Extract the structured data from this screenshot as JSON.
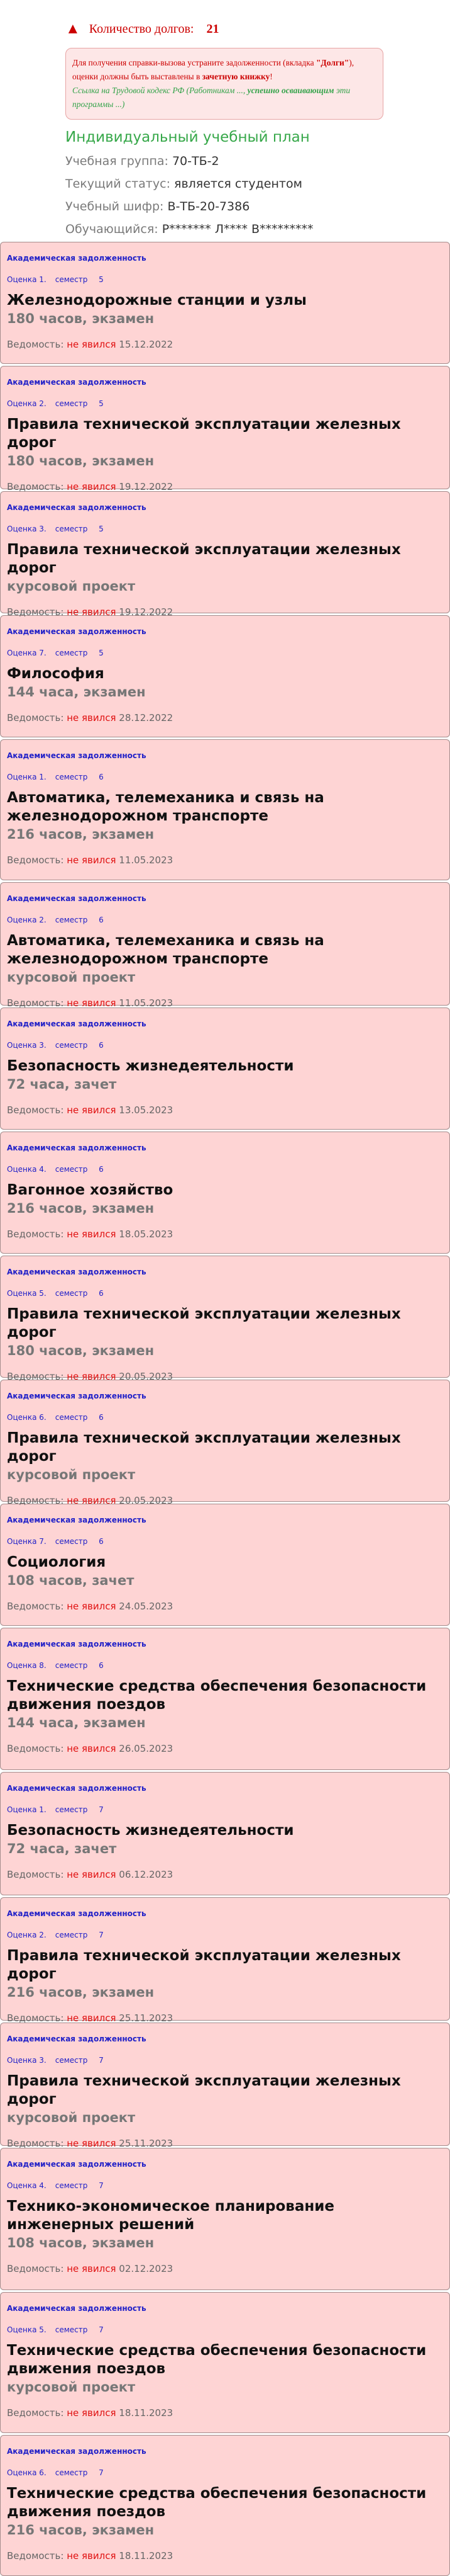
{
  "debts": {
    "label": "Количество долгов:",
    "count": "21"
  },
  "notice": {
    "message_pre": "Для получения справки-вызова устраните задолженности (вкладка ",
    "message_tab": "\"Долги\"",
    "message_post": "), оценки должны быть выставлены в ",
    "message_book": "зачетную книжку",
    "message_end": "!",
    "link_pre": "Ссылка на Трудовой кодекс РФ (Работникам ..., ",
    "link_bold": "успешно осваивающим",
    "link_post": " эти программы ...)"
  },
  "plan_title": "Индивидуальный учебный план",
  "info": {
    "group_label": "Учебная группа:",
    "group_value": "70-ТБ-2",
    "status_label": "Текущий статус:",
    "status_value": "является студентом",
    "cipher_label": "Учебный шифр:",
    "cipher_value": "В-ТБ-20-7386",
    "student_label": "Обучающийся:",
    "student_value": "Р******* Л**** В*********"
  },
  "labels": {
    "debt_tag": "Академическая задолженность",
    "semester": "семестр",
    "statement": "Ведомость:",
    "absent": "не явился"
  },
  "debts_list": [
    {
      "grade": "Оценка 1.",
      "semester": "5",
      "title": "Железнодорожные станции и узлы",
      "hours": "180 часов, экзамен",
      "date": "15.12.2022"
    },
    {
      "grade": "Оценка 2.",
      "semester": "5",
      "title": "Правила технической эксплуатации железных дорог",
      "hours": "180 часов, экзамен",
      "date": "19.12.2022"
    },
    {
      "grade": "Оценка 3.",
      "semester": "5",
      "title": "Правила технической эксплуатации железных дорог",
      "hours": "курсовой проект",
      "date": "19.12.2022"
    },
    {
      "grade": "Оценка 7.",
      "semester": "5",
      "title": "Философия",
      "hours": "144 часа, экзамен",
      "date": "28.12.2022"
    },
    {
      "grade": "Оценка 1.",
      "semester": "6",
      "title": "Автоматика, телемеханика и связь на железнодорожном транспорте",
      "hours": "216 часов, экзамен",
      "date": "11.05.2023"
    },
    {
      "grade": "Оценка 2.",
      "semester": "6",
      "title": "Автоматика, телемеханика и связь на железнодорожном транспорте",
      "hours": "курсовой проект",
      "date": "11.05.2023"
    },
    {
      "grade": "Оценка 3.",
      "semester": "6",
      "title": "Безопасность жизнедеятельности",
      "hours": "72 часа, зачет",
      "date": "13.05.2023"
    },
    {
      "grade": "Оценка 4.",
      "semester": "6",
      "title": "Вагонное хозяйство",
      "hours": "216 часов, экзамен",
      "date": "18.05.2023"
    },
    {
      "grade": "Оценка 5.",
      "semester": "6",
      "title": "Правила технической эксплуатации железных дорог",
      "hours": "180 часов, экзамен",
      "date": "20.05.2023"
    },
    {
      "grade": "Оценка 6.",
      "semester": "6",
      "title": "Правила технической эксплуатации железных дорог",
      "hours": "курсовой проект",
      "date": "20.05.2023"
    },
    {
      "grade": "Оценка 7.",
      "semester": "6",
      "title": "Социология",
      "hours": "108 часов, зачет",
      "date": "24.05.2023"
    },
    {
      "grade": "Оценка 8.",
      "semester": "6",
      "title": "Технические средства обеспечения безопасности движения поездов",
      "hours": "144 часа, экзамен",
      "date": "26.05.2023"
    },
    {
      "grade": "Оценка 1.",
      "semester": "7",
      "title": "Безопасность жизнедеятельности",
      "hours": "72 часа, зачет",
      "date": "06.12.2023"
    },
    {
      "grade": "Оценка 2.",
      "semester": "7",
      "title": "Правила технической эксплуатации железных дорог",
      "hours": "216 часов, экзамен",
      "date": "25.11.2023"
    },
    {
      "grade": "Оценка 3.",
      "semester": "7",
      "title": "Правила технической эксплуатации железных дорог",
      "hours": "курсовой проект",
      "date": "25.11.2023"
    },
    {
      "grade": "Оценка 4.",
      "semester": "7",
      "title": "Технико-экономическое планирование инженерных решений",
      "hours": "108 часов, экзамен",
      "date": "02.12.2023"
    },
    {
      "grade": "Оценка 5.",
      "semester": "7",
      "title": "Технические средства обеспечения безопасности движения поездов",
      "hours": "курсовой проект",
      "date": "18.11.2023"
    },
    {
      "grade": "Оценка 6.",
      "semester": "7",
      "title": "Технические средства обеспечения безопасности движения поездов",
      "hours": "216 часов, экзамен",
      "date": "18.11.2023"
    }
  ]
}
